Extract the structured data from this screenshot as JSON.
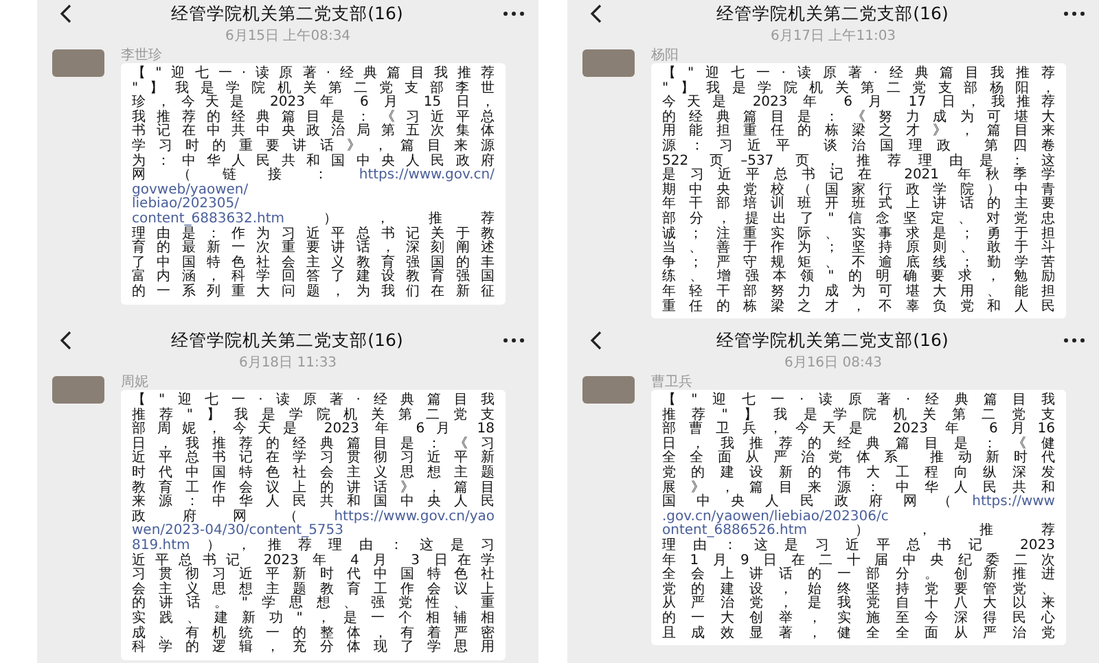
{
  "panels": [
    {
      "title": "经管学院机关第二党支部(16)",
      "time": "6月15日 上午08:34",
      "sender": "李世珍",
      "lines": [
        [
          {
            "kind": "text",
            "text": "【\"迎七一·读原著·经典篇目我推荐"
          }
        ],
        [
          {
            "kind": "text",
            "text": "\"】我是学院机关第二党支部李世"
          }
        ],
        [
          {
            "kind": "text",
            "text": "珍，今天是 2023 年 6 月 15 日，"
          }
        ],
        [
          {
            "kind": "text",
            "text": "我推荐的经典篇目是：《习近平总"
          }
        ],
        [
          {
            "kind": "text",
            "text": "书记在中共中央政治局第五次集体"
          }
        ],
        [
          {
            "kind": "text",
            "text": "学习时的重要讲话》，篇目来源"
          }
        ],
        [
          {
            "kind": "text",
            "text": "为：中华人民共和国中央人民政府"
          }
        ],
        [
          {
            "kind": "text",
            "text": "网（链接："
          },
          {
            "kind": "link",
            "text": "https://www.gov.cn/"
          }
        ],
        [
          {
            "kind": "link",
            "text": "govweb/yaowen/"
          }
        ],
        [
          {
            "kind": "link",
            "text": "liebiao/202305/"
          }
        ],
        [
          {
            "kind": "link",
            "text": "content_6883632.htm"
          },
          {
            "kind": "text",
            "text": "），推荐"
          }
        ],
        [
          {
            "kind": "text",
            "text": "理由是：作为习近平总书记关于教"
          }
        ],
        [
          {
            "kind": "text",
            "text": "育的最新一次重要讲话，深刻阐述"
          }
        ],
        [
          {
            "kind": "text",
            "text": "了中国特色社会主义教育强国的丰"
          }
        ],
        [
          {
            "kind": "text",
            "text": "富内涵，科学回答了建设教育强国"
          }
        ],
        [
          {
            "kind": "text",
            "text": "的一系列重大问题，为我们在新征"
          }
        ]
      ]
    },
    {
      "title": "经管学院机关第二党支部(16)",
      "time": "6月17日 上午11:03",
      "sender": "杨阳",
      "lines": [
        [
          {
            "kind": "text",
            "text": "【\"迎七一·读原著·经典篇目我推荐"
          }
        ],
        [
          {
            "kind": "text",
            "text": "\"】我是学院机关第二党支部杨阳，"
          }
        ],
        [
          {
            "kind": "text",
            "text": "今天是 2023 年 6 月 17 日，我推荐"
          }
        ],
        [
          {
            "kind": "text",
            "text": "的经典篇目是：《努力成为可堪大"
          }
        ],
        [
          {
            "kind": "text",
            "text": "用能担重任的栋梁之才》，篇目来"
          }
        ],
        [
          {
            "kind": "text",
            "text": "源：习近平 谈治国理政 第四卷"
          }
        ],
        [
          {
            "kind": "text",
            "text": "522 页–537 页，推荐理由是：这"
          }
        ],
        [
          {
            "kind": "text",
            "text": "是习近平总书记在 2021 年秋季学"
          }
        ],
        [
          {
            "kind": "text",
            "text": "期中央党校（国家行政学院）中青"
          }
        ],
        [
          {
            "kind": "text",
            "text": "年干部培训班开班式上讲话的主要"
          }
        ],
        [
          {
            "kind": "text",
            "text": "部分，提出了\"信念坚定、对党忠"
          }
        ],
        [
          {
            "kind": "text",
            "text": "诚；注重实际、实事求是；勇于担"
          }
        ],
        [
          {
            "kind": "text",
            "text": "当、善于作为；坚持原则、敢于斗"
          }
        ],
        [
          {
            "kind": "text",
            "text": "争；严守规矩、不逾底线；勤学苦"
          }
        ],
        [
          {
            "kind": "text",
            "text": "练、增强本领\"的明确要求，勉励"
          }
        ],
        [
          {
            "kind": "text",
            "text": "年轻干部努力成为可堪大用、能担"
          }
        ],
        [
          {
            "kind": "text",
            "text": "重任的栋梁之才，不辜负党和人民"
          }
        ]
      ]
    },
    {
      "title": "经管学院机关第二党支部(16)",
      "time": "6月18日 11:33",
      "sender": "周妮",
      "lines": [
        [
          {
            "kind": "text",
            "text": "【\"迎七一·读原著·经典篇目我"
          }
        ],
        [
          {
            "kind": "text",
            "text": "推荐\"】我是学院机关第二党支"
          }
        ],
        [
          {
            "kind": "text",
            "text": "部周妮，今天是 2023 年 6月 18"
          }
        ],
        [
          {
            "kind": "text",
            "text": "日，我推荐的经典篇目是：《习"
          }
        ],
        [
          {
            "kind": "text",
            "text": "近平总书记在学习贯彻习近平新"
          }
        ],
        [
          {
            "kind": "text",
            "text": "时代中国特色社会主义思想主题"
          }
        ],
        [
          {
            "kind": "text",
            "text": "教育工作会议上的讲话》，篇目"
          }
        ],
        [
          {
            "kind": "text",
            "text": "来源：中华人民共和国中央人民"
          }
        ],
        [
          {
            "kind": "text",
            "text": "政府网（"
          },
          {
            "kind": "link",
            "text": "https://www.gov.cn/yao"
          }
        ],
        [
          {
            "kind": "link",
            "text": "wen/2023-04/30/content_5753"
          }
        ],
        [
          {
            "kind": "link",
            "text": "819.htm"
          },
          {
            "kind": "text",
            "text": "），推荐理由：这是习"
          }
        ],
        [
          {
            "kind": "text",
            "text": "近平总书记 2023 年 4 月 3 日在学"
          }
        ],
        [
          {
            "kind": "text",
            "text": "习贯彻习近平新时代中国特色社"
          }
        ],
        [
          {
            "kind": "text",
            "text": "会主义思想主题教育工作会议上"
          }
        ],
        [
          {
            "kind": "text",
            "text": "的讲话。\"学思想、强党性、重"
          }
        ],
        [
          {
            "kind": "text",
            "text": "实践、建新功\"，是一个相辅相"
          }
        ],
        [
          {
            "kind": "text",
            "text": "成、有机统一的整体，有着严密"
          }
        ],
        [
          {
            "kind": "text",
            "text": "科学的逻辑，充分体现了学思用"
          }
        ]
      ]
    },
    {
      "title": "经管学院机关第二党支部(16)",
      "time": "6月16日 08:43",
      "sender": "曹卫兵",
      "lines": [
        [
          {
            "kind": "text",
            "text": "【\"迎七一·读原著·经典篇目我"
          }
        ],
        [
          {
            "kind": "text",
            "text": "推荐\"】我是学院机关第二党支"
          }
        ],
        [
          {
            "kind": "text",
            "text": "部曹卫兵，今天是 2023 年 6月16"
          }
        ],
        [
          {
            "kind": "text",
            "text": "日，我推荐的经典篇目是：《健"
          }
        ],
        [
          {
            "kind": "text",
            "text": "全全面从严治党体系 推动新时代"
          }
        ],
        [
          {
            "kind": "text",
            "text": "党的建设新的伟大工程向纵深发"
          }
        ],
        [
          {
            "kind": "text",
            "text": "展》，篇目来源：中华人民共和"
          }
        ],
        [
          {
            "kind": "text",
            "text": "国中央人民政府网（"
          },
          {
            "kind": "link",
            "text": "https://www"
          }
        ],
        [
          {
            "kind": "link",
            "text": ".gov.cn/yaowen/liebiao/202306/c"
          }
        ],
        [
          {
            "kind": "link",
            "text": "ontent_6886526.htm"
          },
          {
            "kind": "text",
            "text": "），推荐"
          }
        ],
        [
          {
            "kind": "text",
            "text": "理由：这是习近平总书记 2023"
          }
        ],
        [
          {
            "kind": "text",
            "text": "年1月9日在二十届中央纪委二次"
          }
        ],
        [
          {
            "kind": "text",
            "text": "全会上讲话的一部分。创新推进"
          }
        ],
        [
          {
            "kind": "text",
            "text": "党的建设，始终坚持党要管党、"
          }
        ],
        [
          {
            "kind": "text",
            "text": "从严治党，是我党自十八大以来"
          }
        ],
        [
          {
            "kind": "text",
            "text": "的一大创举，实施至今深得民心"
          }
        ],
        [
          {
            "kind": "text",
            "text": "且成效显著，健全全面从严治党"
          }
        ]
      ]
    }
  ]
}
